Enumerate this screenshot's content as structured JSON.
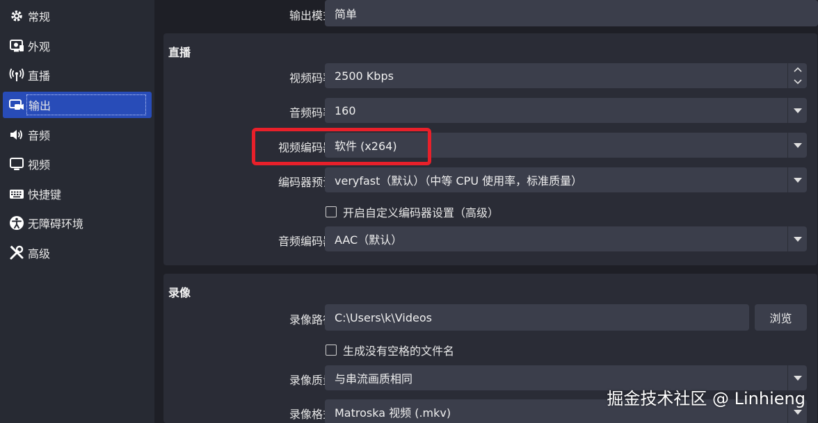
{
  "sidebar": {
    "items": [
      {
        "label": "常规",
        "icon": "gear-icon"
      },
      {
        "label": "外观",
        "icon": "appearance-icon"
      },
      {
        "label": "直播",
        "icon": "broadcast-icon"
      },
      {
        "label": "输出",
        "icon": "output-icon",
        "active": true
      },
      {
        "label": "音频",
        "icon": "speaker-icon"
      },
      {
        "label": "视频",
        "icon": "monitor-icon"
      },
      {
        "label": "快捷键",
        "icon": "keyboard-icon"
      },
      {
        "label": "无障碍环境",
        "icon": "accessibility-icon"
      },
      {
        "label": "高级",
        "icon": "tools-icon"
      }
    ]
  },
  "output_mode": {
    "label": "输出模式",
    "value": "简单"
  },
  "streaming": {
    "title": "直播",
    "video_bitrate": {
      "label": "视频码率",
      "value": "2500 Kbps"
    },
    "audio_bitrate": {
      "label": "音频码率",
      "value": "160"
    },
    "video_encoder": {
      "label": "视频编码器",
      "value": "软件 (x264)"
    },
    "encoder_preset": {
      "label": "编码器预设",
      "value": "veryfast（默认）（中等 CPU 使用率，标准质量）"
    },
    "custom_encoder_checkbox": {
      "label": "开启自定义编码器设置（高级）",
      "checked": false
    },
    "audio_encoder": {
      "label": "音频编码器",
      "value": "AAC（默认）"
    }
  },
  "recording": {
    "title": "录像",
    "path": {
      "label": "录像路径",
      "value": "C:\\Users\\k\\Videos",
      "browse_label": "浏览"
    },
    "no_space_checkbox": {
      "label": "生成没有空格的文件名",
      "checked": false
    },
    "quality": {
      "label": "录像质量",
      "value": "与串流画质相同"
    },
    "format": {
      "label": "录像格式",
      "value": "Matroska 视频 (.mkv)"
    }
  },
  "watermark": "掘金技术社区 @ Linhieng",
  "colors": {
    "accent": "#284cb8",
    "highlight": "#e8202a"
  }
}
